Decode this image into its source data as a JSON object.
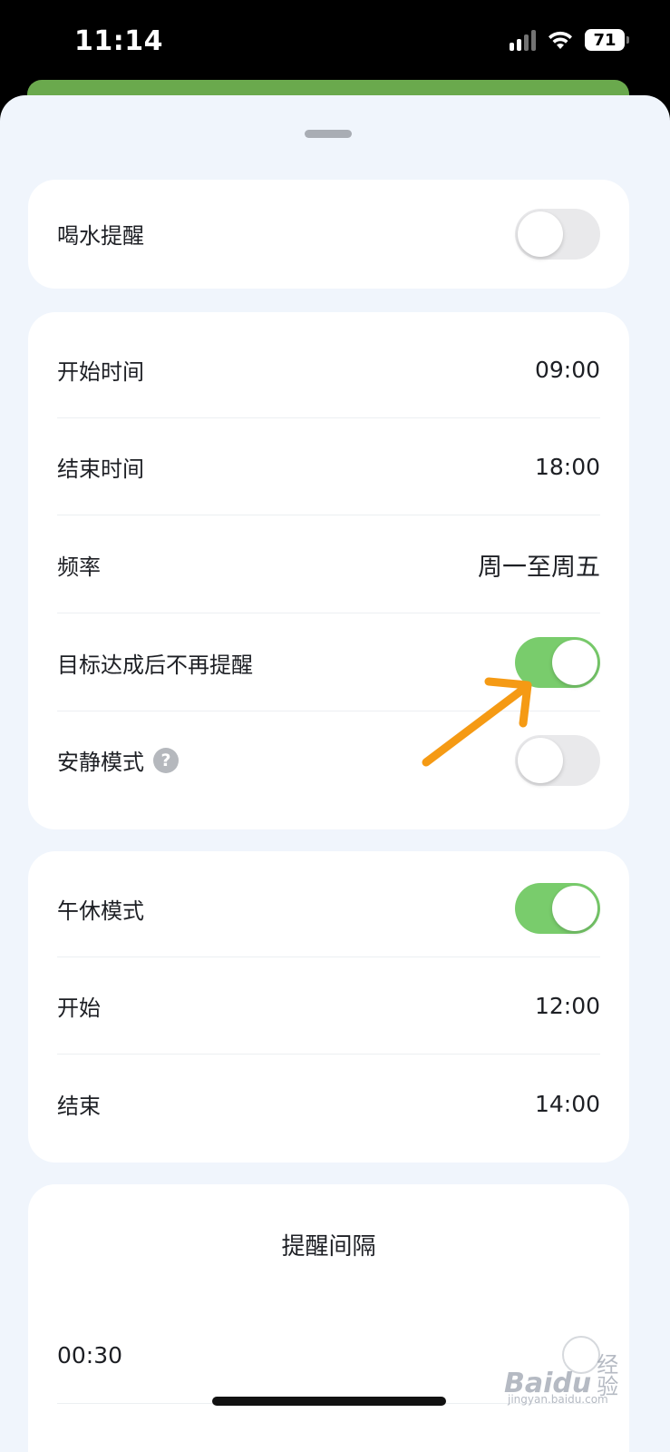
{
  "status_bar": {
    "time": "11:14",
    "battery": "71",
    "icons": [
      "cellular-icon",
      "wifi-icon",
      "battery-icon"
    ]
  },
  "reminder_card": {
    "label": "喝水提醒",
    "enabled": false
  },
  "schedule_card": {
    "start_time": {
      "label": "开始时间",
      "value": "09:00"
    },
    "end_time": {
      "label": "结束时间",
      "value": "18:00"
    },
    "frequency": {
      "label": "频率",
      "value": "周一至周五"
    },
    "stop_after_goal": {
      "label": "目标达成后不再提醒",
      "enabled": true
    },
    "quiet_mode": {
      "label": "安静模式",
      "help_glyph": "?",
      "enabled": false
    }
  },
  "nap_card": {
    "nap_mode": {
      "label": "午休模式",
      "enabled": true
    },
    "start": {
      "label": "开始",
      "value": "12:00"
    },
    "end": {
      "label": "结束",
      "value": "14:00"
    }
  },
  "interval_card": {
    "title": "提醒间隔",
    "options": [
      {
        "label": "00:30"
      }
    ]
  },
  "colors": {
    "toggle_on": "#79cc6c",
    "toggle_off": "#e9e9eb",
    "sheet_background": "#f0f5fc",
    "annotation_arrow": "#f59a14"
  },
  "watermark": {
    "brand": "Baidu",
    "sub": "经验",
    "url": "jingyan.baidu.com"
  }
}
